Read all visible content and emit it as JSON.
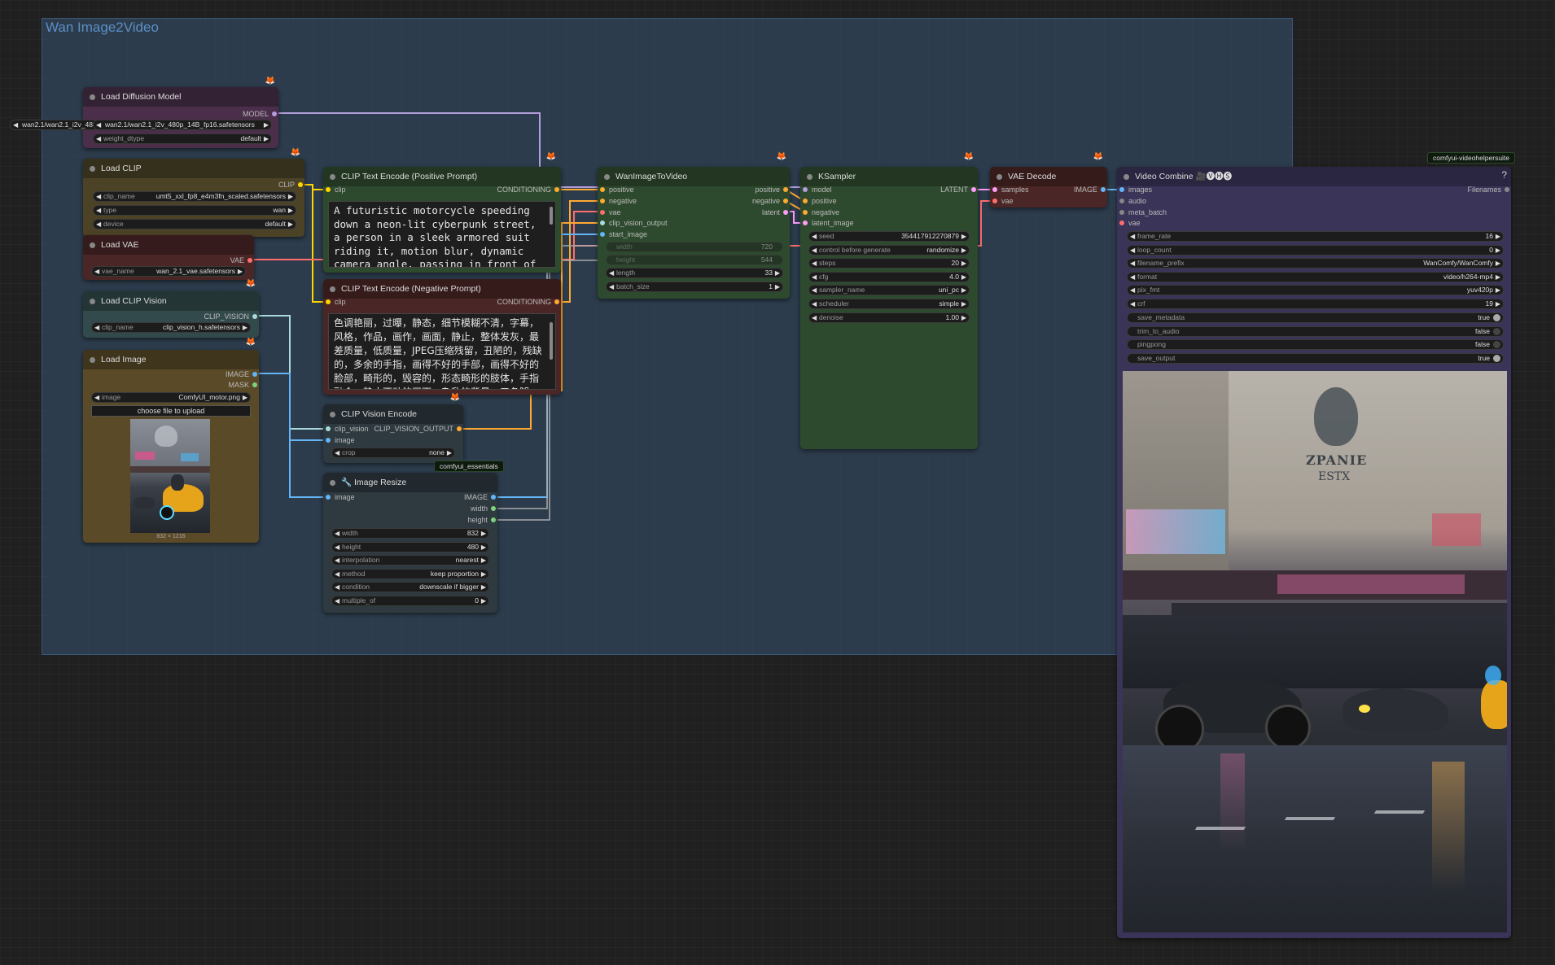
{
  "group": {
    "title": "Wan Image2Video"
  },
  "nodes": {
    "load_diffusion": {
      "title": "Load Diffusion Model",
      "output": "MODEL",
      "unet_name": "wan2.1/wan2.1_i2v_480p_14B_fp16.safetensors",
      "weight_dtype_label": "weight_dtype",
      "weight_dtype": "default"
    },
    "load_clip": {
      "title": "Load CLIP",
      "output": "CLIP",
      "clip_name_label": "clip_name",
      "clip_name": "umt5_xxl_fp8_e4m3fn_scaled.safetensors",
      "type_label": "type",
      "type": "wan",
      "device_label": "device",
      "device": "default"
    },
    "load_vae": {
      "title": "Load VAE",
      "output": "VAE",
      "vae_name_label": "vae_name",
      "vae_name": "wan_2.1_vae.safetensors"
    },
    "load_clip_vision": {
      "title": "Load CLIP Vision",
      "output": "CLIP_VISION",
      "clip_name_label": "clip_name",
      "clip_name": "clip_vision_h.safetensors"
    },
    "load_image": {
      "title": "Load Image",
      "out_image": "IMAGE",
      "out_mask": "MASK",
      "image_label": "image",
      "image": "ComfyUI_motor.png",
      "upload": "choose file to upload",
      "size": "832 × 1216"
    },
    "clip_pos": {
      "title": "CLIP Text Encode (Positive Prompt)",
      "in_clip": "clip",
      "output": "CONDITIONING",
      "text": "A futuristic motorcycle speeding down a neon-lit cyberpunk street, a person in a sleek armored suit riding it, motion blur, dynamic camera angle, passing in front of"
    },
    "clip_neg": {
      "title": "CLIP Text Encode (Negative Prompt)",
      "in_clip": "clip",
      "output": "CONDITIONING",
      "text": "色调艳丽，过曝，静态，细节模糊不清，字幕，风格，作品，画作，画面，静止，整体发灰，最差质量，低质量，JPEG压缩残留，丑陋的，残缺的，多余的手指，画得不好的手部，画得不好的脸部，畸形的，毁容的，形态畸形的肢体，手指融合，静止不动的画面，杂乱的背景，三条腿"
    },
    "clip_vision_encode": {
      "title": "CLIP Vision Encode",
      "in_clip_vision": "clip_vision",
      "in_image": "image",
      "output": "CLIP_VISION_OUTPUT",
      "crop_label": "crop",
      "crop": "none"
    },
    "image_resize": {
      "title": "🔧 Image Resize",
      "pack": "comfyui_essentials",
      "in_image": "image",
      "out_image": "IMAGE",
      "out_width": "width",
      "out_height": "height",
      "widgets": [
        {
          "label": "width",
          "value": "832"
        },
        {
          "label": "height",
          "value": "480"
        },
        {
          "label": "interpolation",
          "value": "nearest"
        },
        {
          "label": "method",
          "value": "keep proportion"
        },
        {
          "label": "condition",
          "value": "downscale if bigger"
        },
        {
          "label": "multiple_of",
          "value": "0"
        }
      ]
    },
    "wan_i2v": {
      "title": "WanImageToVideo",
      "inputs": [
        "positive",
        "negative",
        "vae",
        "clip_vision_output",
        "start_image"
      ],
      "outputs": [
        "positive",
        "negative",
        "latent"
      ],
      "width_label": "width",
      "width": "720",
      "height_label": "height",
      "height": "544",
      "length_label": "length",
      "length": "33",
      "batch_label": "batch_size",
      "batch": "1"
    },
    "ksampler": {
      "title": "KSampler",
      "inputs": [
        "model",
        "positive",
        "negative",
        "latent_image"
      ],
      "output": "LATENT",
      "widgets": [
        {
          "label": "seed",
          "value": "354417912270879"
        },
        {
          "label": "control before generate",
          "value": "randomize"
        },
        {
          "label": "steps",
          "value": "20"
        },
        {
          "label": "cfg",
          "value": "4.0"
        },
        {
          "label": "sampler_name",
          "value": "uni_pc"
        },
        {
          "label": "scheduler",
          "value": "simple"
        },
        {
          "label": "denoise",
          "value": "1.00"
        }
      ]
    },
    "vae_decode": {
      "title": "VAE Decode",
      "in_samples": "samples",
      "in_vae": "vae",
      "output": "IMAGE"
    },
    "video_combine": {
      "title": "Video Combine 🎥🅥🅗🅢",
      "pack": "comfyui-videohelpersuite",
      "help": "?",
      "inputs": [
        "images",
        "audio",
        "meta_batch",
        "vae"
      ],
      "output": "Filenames",
      "widgets": [
        {
          "label": "frame_rate",
          "value": "16"
        },
        {
          "label": "loop_count",
          "value": "0"
        },
        {
          "label": "filename_prefix",
          "value": "WanComfy/WanComfy"
        },
        {
          "label": "format",
          "value": "video/h264-mp4"
        },
        {
          "label": "pix_fmt",
          "value": "yuv420p"
        },
        {
          "label": "crf",
          "value": "19"
        }
      ],
      "toggles": [
        {
          "label": "save_metadata",
          "value": "true"
        },
        {
          "label": "trim_to_audio",
          "value": "false"
        },
        {
          "label": "pingpong",
          "value": "false"
        },
        {
          "label": "save_output",
          "value": "true"
        }
      ],
      "preview_sign_1": "ZPANIE",
      "preview_sign_2": "ESTX"
    }
  },
  "colors": {
    "model": "#b39ddb",
    "clip": "#ffd500",
    "vae": "#ff6e6e",
    "conditioning": "#ffa931",
    "clip_vision": "#a8dadc",
    "image": "#64b5f6",
    "latent": "#ff9cf9",
    "int": "#7fd17f"
  }
}
